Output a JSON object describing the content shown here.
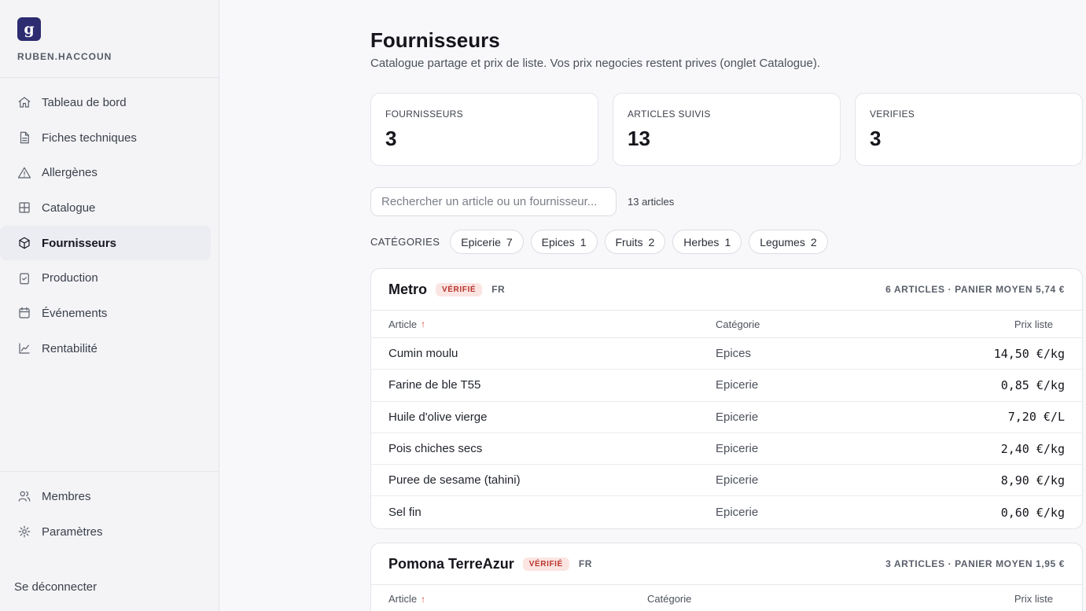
{
  "workspace": {
    "logo_letter": "g",
    "name": "RUBEN.HACCOUN"
  },
  "nav": [
    {
      "label": "Tableau de bord",
      "icon": "home-icon"
    },
    {
      "label": "Fiches techniques",
      "icon": "document-icon"
    },
    {
      "label": "Allergènes",
      "icon": "warning-icon"
    },
    {
      "label": "Catalogue",
      "icon": "grid-icon"
    },
    {
      "label": "Fournisseurs",
      "icon": "package-icon",
      "active": true
    },
    {
      "label": "Production",
      "icon": "clipboard-check-icon"
    },
    {
      "label": "Événements",
      "icon": "calendar-icon"
    },
    {
      "label": "Rentabilité",
      "icon": "chart-line-icon"
    }
  ],
  "bottom_nav": [
    {
      "label": "Membres",
      "icon": "users-icon"
    },
    {
      "label": "Paramètres",
      "icon": "settings-icon"
    }
  ],
  "logout_label": "Se déconnecter",
  "page": {
    "title": "Fournisseurs",
    "subtitle": "Catalogue partage et prix de liste. Vos prix negocies restent prives (onglet Catalogue)."
  },
  "stats": [
    {
      "label": "FOURNISSEURS",
      "value": "3"
    },
    {
      "label": "ARTICLES SUIVIS",
      "value": "13"
    },
    {
      "label": "VERIFIES",
      "value": "3"
    }
  ],
  "search": {
    "placeholder": "Rechercher un article ou un fournisseur...",
    "value": "",
    "count_label": "13 articles"
  },
  "categories": {
    "label": "CATÉGORIES",
    "chips": [
      {
        "label": "Epicerie",
        "count": "7"
      },
      {
        "label": "Epices",
        "count": "1"
      },
      {
        "label": "Fruits",
        "count": "2"
      },
      {
        "label": "Herbes",
        "count": "1"
      },
      {
        "label": "Legumes",
        "count": "2"
      }
    ]
  },
  "suppliers": [
    {
      "name": "Metro",
      "badge": "VÉRIFIÉ",
      "country": "FR",
      "meta": "6 ARTICLES · PANIER MOYEN 5,74 €",
      "columns": {
        "article": "Article",
        "sort": "↑",
        "category": "Catégorie",
        "price": "Prix liste"
      },
      "rows": [
        {
          "article": "Cumin moulu",
          "category": "Epices",
          "price": "14,50 €/kg"
        },
        {
          "article": "Farine de ble T55",
          "category": "Epicerie",
          "price": "0,85 €/kg"
        },
        {
          "article": "Huile d'olive vierge",
          "category": "Epicerie",
          "price": "7,20 €/L"
        },
        {
          "article": "Pois chiches secs",
          "category": "Epicerie",
          "price": "2,40 €/kg"
        },
        {
          "article": "Puree de sesame (tahini)",
          "category": "Epicerie",
          "price": "8,90 €/kg"
        },
        {
          "article": "Sel fin",
          "category": "Epicerie",
          "price": "0,60 €/kg"
        }
      ]
    },
    {
      "name": "Pomona TerreAzur",
      "badge": "VÉRIFIÉ",
      "country": "FR",
      "meta": "3 ARTICLES · PANIER MOYEN 1,95 €",
      "columns": {
        "article": "Article",
        "sort": "↑",
        "category": "Catégorie",
        "price": "Prix liste"
      },
      "rows": []
    }
  ]
}
